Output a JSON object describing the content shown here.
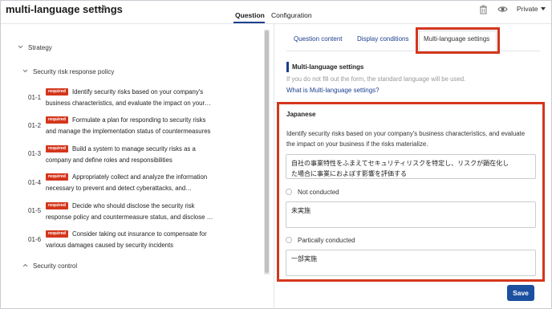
{
  "header": {
    "title": "multi-language settings",
    "tabs": [
      {
        "label": "Question"
      },
      {
        "label": "Configuration"
      }
    ],
    "visibility": "Private"
  },
  "tree": {
    "root": "Strategy",
    "group": "Security risk response policy",
    "items": [
      {
        "num": "01-1",
        "badge": "required",
        "line1": "Identify security risks based on your company's",
        "line2": "business characteristics, and evaluate the impact on your…"
      },
      {
        "num": "01-2",
        "badge": "required",
        "line1": "Formulate a plan for responding to security risks",
        "line2": "and manage the implementation status of countermeasures"
      },
      {
        "num": "01-3",
        "badge": "required",
        "line1": "Build a system to manage security risks as a",
        "line2": "company and define roles and responsibilities"
      },
      {
        "num": "01-4",
        "badge": "required",
        "line1": "Appropriately collect and analyze the information",
        "line2": "necessary to prevent and detect cyberattacks, and…"
      },
      {
        "num": "01-5",
        "badge": "required",
        "line1": "Decide who should disclose the security risk",
        "line2": "response policy and countermeasure status, and disclose …"
      },
      {
        "num": "01-6",
        "badge": "required",
        "line1": "Consider taking out insurance to compensate for",
        "line2": "various damages caused by security incidents"
      }
    ],
    "next_group": "Security control"
  },
  "right": {
    "tabs": [
      {
        "label": "Question content"
      },
      {
        "label": "Display conditions"
      },
      {
        "label": "Multi-language settings"
      }
    ],
    "section_title": "Multi-language settings",
    "hint": "If you do not fill out the form, the standard language will be used.",
    "link": "What is Multi-language settings?",
    "language": "Japanese",
    "description_line1": "Identify security risks based on your company's business characteristics, and evaluate",
    "description_line2": "the impact on your business if the risks materialize.",
    "question_translation": "自社の事業特性をふまえてセキュリティリスクを特定し、リスクが顕在化し\nた場合に事業におよぼす影響を評価する",
    "options": [
      {
        "label": "Not conducted",
        "translation": "未実施"
      },
      {
        "label": "Partically conducted",
        "translation": "一部実施"
      }
    ],
    "save_label": "Save"
  },
  "colors": {
    "accent": "#1b3f8f",
    "highlight": "#d4361c",
    "required_badge": "#d4361c",
    "save_button": "#1b4fa0"
  },
  "icons": [
    "pencil-icon",
    "trash-icon",
    "eye-icon",
    "caret-down-icon",
    "chevron-down-icon",
    "chevron-up-icon"
  ]
}
